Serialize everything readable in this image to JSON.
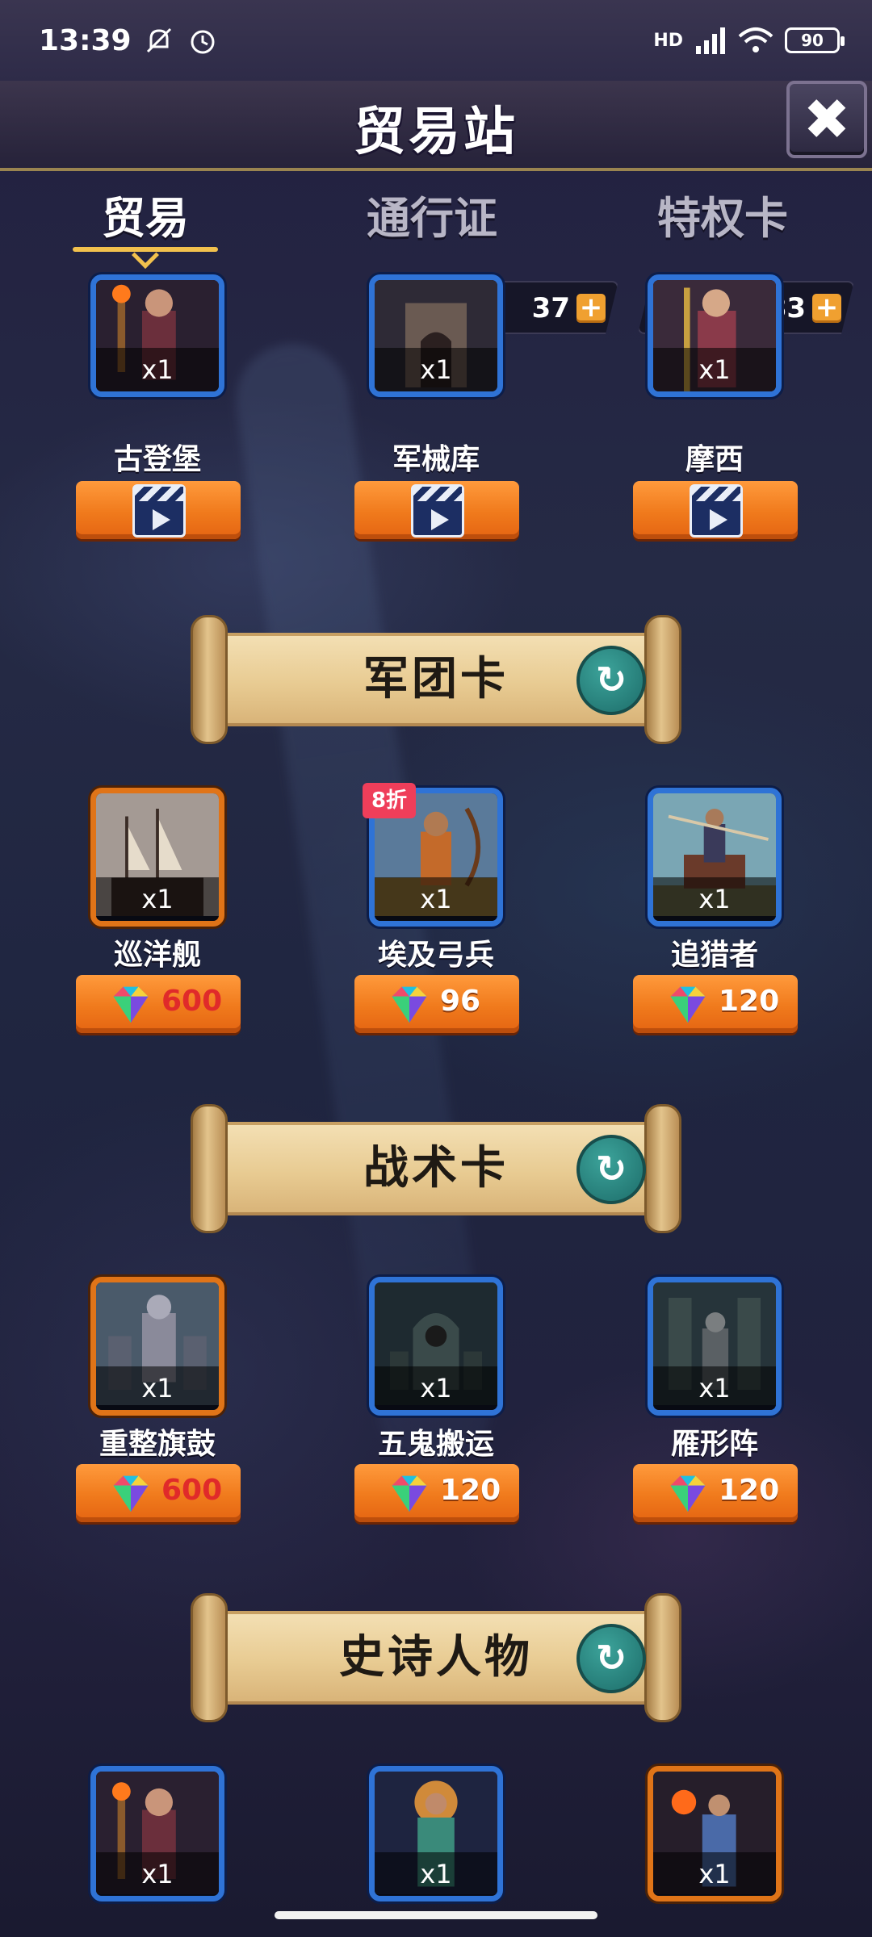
{
  "status": {
    "time": "13:39",
    "network": "HD",
    "battery": "90"
  },
  "header": {
    "title": "贸易站",
    "close": "✖"
  },
  "tabs": [
    {
      "label": "贸易"
    },
    {
      "label": "通行证"
    },
    {
      "label": "特权卡"
    }
  ],
  "currencies": [
    {
      "icon": "emblem-icon",
      "value": "37",
      "plus": "+"
    },
    {
      "icon": "gem-icon",
      "value": "483",
      "plus": "+"
    }
  ],
  "top_items": [
    {
      "name": "古登堡",
      "qty": "x1",
      "frame": "blue",
      "cost": "video"
    },
    {
      "name": "军械库",
      "qty": "x1",
      "frame": "blue",
      "cost": "video"
    },
    {
      "name": "摩西",
      "qty": "x1",
      "frame": "blue",
      "cost": "video"
    }
  ],
  "sections": [
    {
      "title": "军团卡",
      "refresh": "↻",
      "items": [
        {
          "name": "巡洋舰",
          "qty": "x1",
          "frame": "orange",
          "price": "600",
          "price_color": "red"
        },
        {
          "name": "埃及弓兵",
          "qty": "x1",
          "frame": "blue",
          "price": "96",
          "badge": "8折"
        },
        {
          "name": "追猎者",
          "qty": "x1",
          "frame": "blue",
          "price": "120"
        }
      ]
    },
    {
      "title": "战术卡",
      "refresh": "↻",
      "items": [
        {
          "name": "重整旗鼓",
          "qty": "x1",
          "frame": "orange",
          "price": "600",
          "price_color": "red"
        },
        {
          "name": "五鬼搬运",
          "qty": "x1",
          "frame": "blue",
          "price": "120"
        },
        {
          "name": "雁形阵",
          "qty": "x1",
          "frame": "blue",
          "price": "120"
        }
      ]
    },
    {
      "title": "史诗人物",
      "refresh": "↻",
      "items": [
        {
          "qty": "x1",
          "frame": "blue"
        },
        {
          "qty": "x1",
          "frame": "blue"
        },
        {
          "qty": "x1",
          "frame": "orange"
        }
      ]
    }
  ],
  "colors": {
    "accent": "#f2c14d",
    "button": "#f07a1c",
    "blue_frame": "#2f73d6",
    "orange_frame": "#e07418"
  }
}
